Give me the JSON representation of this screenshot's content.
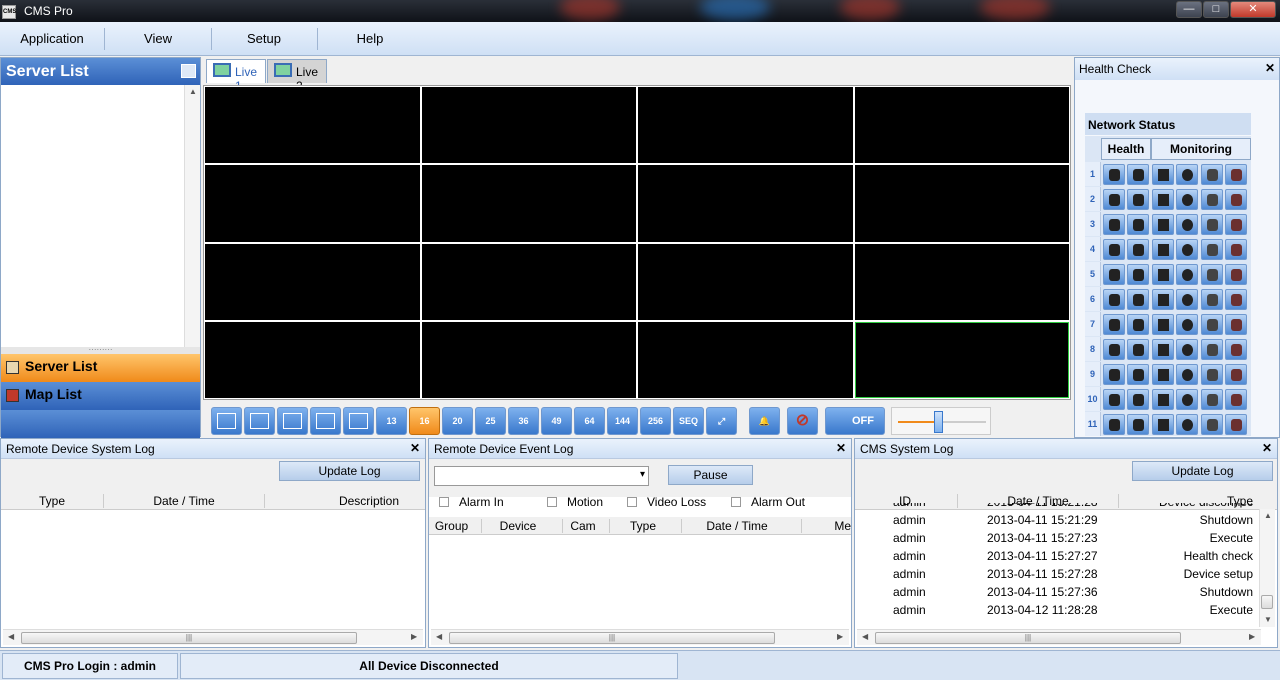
{
  "window": {
    "title": "CMS Pro",
    "app_icon_text": "CMS",
    "min": "—",
    "max": "□",
    "close": "✕"
  },
  "menu": [
    {
      "label": "Application"
    },
    {
      "label": "View"
    },
    {
      "label": "Setup"
    },
    {
      "label": "Help"
    }
  ],
  "left": {
    "header": "Server List",
    "nav_server": "Server List",
    "nav_map": "Map List"
  },
  "live": {
    "tabs": [
      "Live 1",
      "Live 2"
    ],
    "selected_cell": 16
  },
  "toolbar": {
    "layouts": [
      "",
      "",
      "",
      "",
      "",
      "13",
      "16",
      "20",
      "25",
      "36",
      "49",
      "64",
      "144",
      "256",
      "SEQ",
      "⤢"
    ],
    "active_layout": "16",
    "off_label": "OFF",
    "volume_level": 0.45
  },
  "health": {
    "title": "Health Check",
    "close": "✕",
    "network_status": "Network Status",
    "col_health": "Health",
    "col_monitoring": "Monitoring",
    "rows": [
      "1",
      "2",
      "3",
      "4",
      "5",
      "6",
      "7",
      "8",
      "9",
      "10",
      "11"
    ]
  },
  "remote_system_log": {
    "title": "Remote Device System Log",
    "close": "✕",
    "update_btn": "Update Log",
    "columns": [
      "Type",
      "Date / Time",
      "Description"
    ]
  },
  "remote_event_log": {
    "title": "Remote Device Event Log",
    "close": "✕",
    "pause_btn": "Pause",
    "filters": [
      "Alarm In",
      "Motion",
      "Video Loss",
      "Alarm Out"
    ],
    "columns": [
      "Group",
      "Device",
      "Cam",
      "Type",
      "Date / Time",
      "Me"
    ]
  },
  "cms_log": {
    "title": "CMS System Log",
    "close": "✕",
    "update_btn": "Update Log",
    "columns": [
      "ID",
      "Date / Time",
      "Type"
    ],
    "rows": [
      {
        "id": "admin",
        "datetime": "2013-04-11 15:21:28",
        "type": "Device disconnec"
      },
      {
        "id": "admin",
        "datetime": "2013-04-11 15:21:29",
        "type": "Shutdown"
      },
      {
        "id": "admin",
        "datetime": "2013-04-11 15:27:23",
        "type": "Execute"
      },
      {
        "id": "admin",
        "datetime": "2013-04-11 15:27:27",
        "type": "Health check"
      },
      {
        "id": "admin",
        "datetime": "2013-04-11 15:27:28",
        "type": "Device setup"
      },
      {
        "id": "admin",
        "datetime": "2013-04-11 15:27:36",
        "type": "Shutdown"
      },
      {
        "id": "admin",
        "datetime": "2013-04-12 11:28:28",
        "type": "Execute"
      }
    ]
  },
  "status": {
    "login": "CMS Pro Login : admin",
    "message": "All Device Disconnected"
  }
}
